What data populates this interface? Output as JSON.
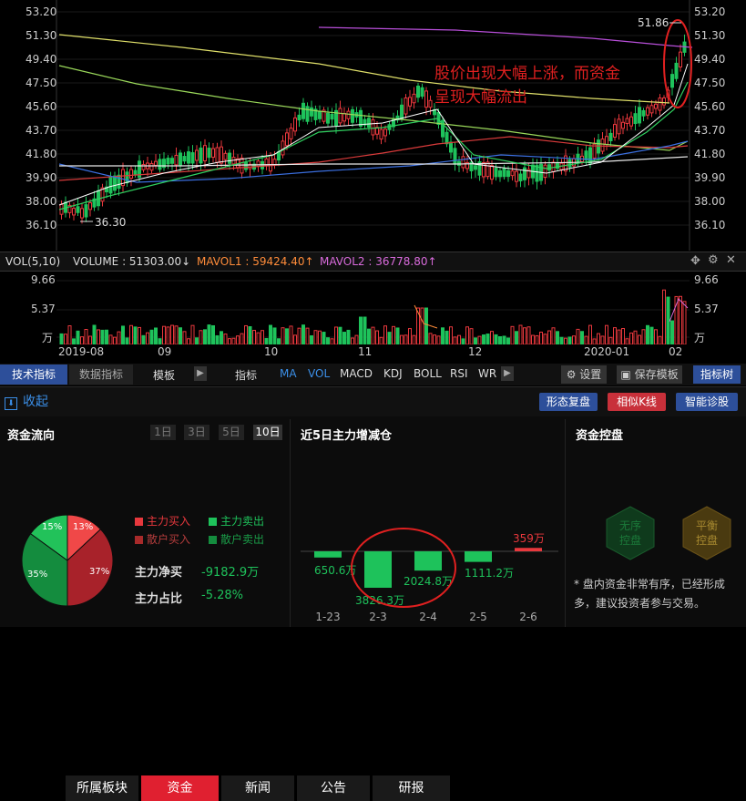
{
  "price_axis": {
    "labels": [
      "53.20",
      "51.30",
      "49.40",
      "47.50",
      "45.60",
      "43.70",
      "41.80",
      "39.90",
      "38.00",
      "36.10"
    ]
  },
  "annotations": {
    "high_value": "51.86",
    "low_value": "36.30",
    "callout_line1": "股价出现大幅上涨，而资金",
    "callout_line2": "呈现大幅流出"
  },
  "vol_bar": {
    "indicator": "VOL(5,10)",
    "volume": "VOLUME : 51303.00↓",
    "mavol1": "MAVOL1 : 59424.40↑",
    "mavol2": "MAVOL2 : 36778.80↑"
  },
  "vol_axis": {
    "labels": [
      "9.66",
      "5.37"
    ],
    "unit": "万",
    "right_labels": [
      "9.66",
      "5.37",
      "万"
    ]
  },
  "date_axis": [
    "2019-08",
    "09",
    "10",
    "11",
    "12",
    "2020-01",
    "02"
  ],
  "indicator_bar": {
    "tabs": [
      "技术指标",
      "数据指标"
    ],
    "template_label": "模板",
    "indicator_label": "指标",
    "indicators": [
      "MA",
      "VOL",
      "MACD",
      "KDJ",
      "BOLL",
      "RSI",
      "WR"
    ],
    "settings": "设置",
    "save_template": "保存模板",
    "tree": "指标树"
  },
  "nav": {
    "collapse": "收起",
    "tabs": [
      "所属板块",
      "资金",
      "新闻",
      "公告",
      "研报"
    ],
    "active_tab": "资金",
    "buttons": [
      "形态复盘",
      "相似K线",
      "智能诊股"
    ]
  },
  "fund_flow": {
    "title": "资金流向",
    "periods": [
      "1日",
      "3日",
      "5日",
      "10日"
    ],
    "active_period": "10日",
    "legend": [
      "主力买入",
      "主力卖出",
      "散户买入",
      "散户卖出"
    ],
    "pie_labels": [
      "15%",
      "13%",
      "35%",
      "37%"
    ],
    "net_buy_label": "主力净买",
    "net_buy_value": "-9182.9万",
    "share_label": "主力占比",
    "share_value": "-5.28%"
  },
  "five_day": {
    "title": "近5日主力增减仓",
    "dates": [
      "1-23",
      "2-3",
      "2-4",
      "2-5",
      "2-6"
    ],
    "values_text": [
      "650.6万",
      "3826.3万",
      "2024.8万",
      "1111.2万",
      "359万"
    ]
  },
  "control": {
    "title": "资金控盘",
    "badge1": "无序\n控盘",
    "badge1_line1": "无序",
    "badge1_line2": "控盘",
    "badge2_line1": "平衡",
    "badge2_line2": "控盘",
    "note": "* 盘内资金非常有序，已经形成",
    "note2": "多，建议投资者参与交易。"
  },
  "colors": {
    "up": "#e8383d",
    "down": "#1ec25b",
    "accent_red": "#e02020",
    "blue_btn": "#2d4f9a"
  },
  "chart_data": {
    "type": "table",
    "five_day_net_flow_wan": [
      {
        "date": "1-23",
        "value": -650.6
      },
      {
        "date": "2-3",
        "value": -3826.3
      },
      {
        "date": "2-4",
        "value": -2024.8
      },
      {
        "date": "2-5",
        "value": -1111.2
      },
      {
        "date": "2-6",
        "value": 359
      }
    ],
    "fund_pie_percent": [
      {
        "name": "主力买入",
        "value": 13
      },
      {
        "name": "散户买入",
        "value": 37
      },
      {
        "name": "散户卖出",
        "value": 35
      },
      {
        "name": "主力卖出",
        "value": 15
      }
    ]
  }
}
